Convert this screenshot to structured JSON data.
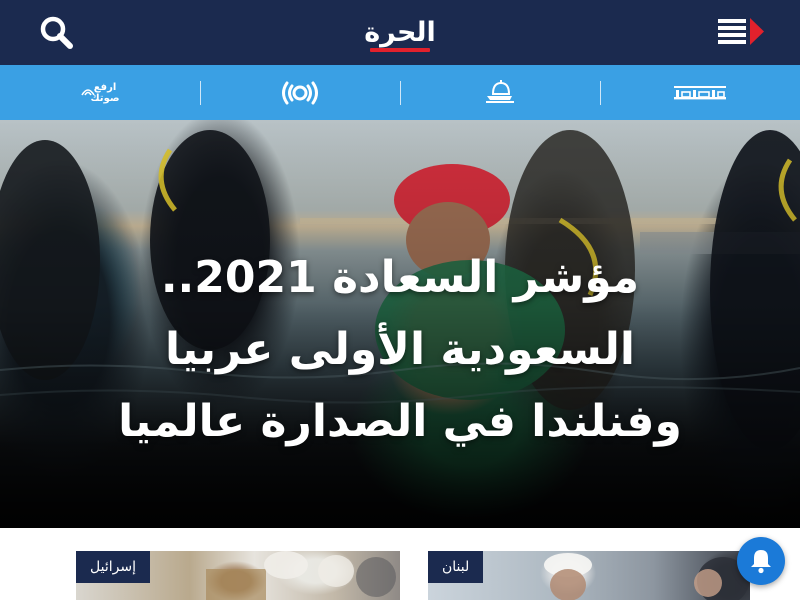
{
  "header": {
    "logo_text": "الحرة",
    "colors": {
      "background": "#1b2a4f",
      "logo_accent": "#e2212c"
    },
    "icons": {
      "search": "search-icon",
      "menu": "hamburger-menu-icon"
    }
  },
  "subnav": {
    "background": "#3aa0e4",
    "items": [
      {
        "name": "الساعة",
        "icon": "alsaa-logo-icon"
      },
      {
        "name": "المجلة",
        "icon": "dome-logo-icon"
      },
      {
        "name": "راديو",
        "icon": "radio-broadcast-icon"
      },
      {
        "name": "ارفع صوتك",
        "icon": "irfa-sawtak-logo-icon",
        "label": "ارفع صوتك"
      }
    ]
  },
  "hero": {
    "title_lines": [
      "مؤشر السعادة 2021..",
      "السعودية الأولى عربيا",
      "وفنلندا في الصدارة عالميا"
    ]
  },
  "cards": [
    {
      "tag": "إسرائيل"
    },
    {
      "tag": "لبنان"
    }
  ],
  "notification": {
    "icon": "bell-icon",
    "color": "#1b7ad8"
  }
}
